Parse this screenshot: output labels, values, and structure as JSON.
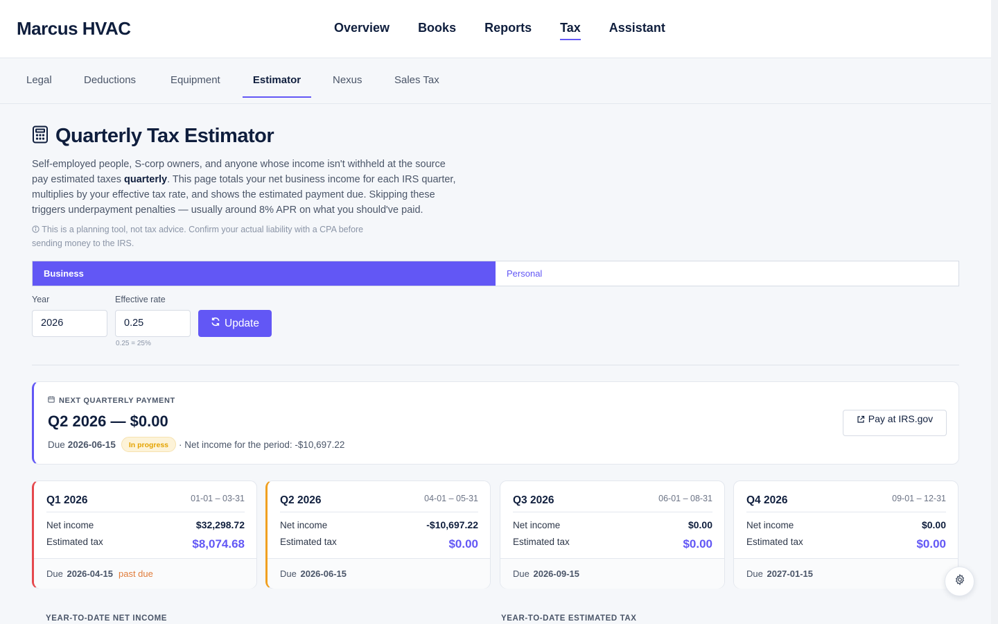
{
  "app": {
    "brand": "Marcus HVAC"
  },
  "mainnav": {
    "items": [
      "Overview",
      "Books",
      "Reports",
      "Tax",
      "Assistant"
    ],
    "active": "Tax"
  },
  "subnav": {
    "items": [
      "Legal",
      "Deductions",
      "Equipment",
      "Estimator",
      "Nexus",
      "Sales Tax"
    ],
    "active": "Estimator"
  },
  "page": {
    "title": "Quarterly Tax Estimator",
    "intro_a": "Self-employed people, S-corp owners, and anyone whose income isn't withheld at the source pay estimated taxes ",
    "intro_bold": "quarterly",
    "intro_b": ". This page totals your net business income for each IRS quarter, multiplies by your effective tax rate, and shows the estimated payment due. Skipping these triggers underpayment penalties — usually around 8% APR on what you should've paid.",
    "disclaimer": "This is a planning tool, not tax advice. Confirm your actual liability with a CPA before sending money to the IRS."
  },
  "toggle": {
    "business": "Business",
    "personal": "Personal",
    "selected": "Business"
  },
  "form": {
    "year_label": "Year",
    "year_value": "2026",
    "rate_label": "Effective rate",
    "rate_value": "0.25",
    "rate_hint": "0.25 = 25%",
    "update_label": "Update"
  },
  "next_payment": {
    "eyebrow": "NEXT QUARTERLY PAYMENT",
    "heading": "Q2 2026 — $0.00",
    "due_prefix": "Due",
    "due_date": "2026-06-15",
    "status": "In progress",
    "net_text": "· Net income for the period: -$10,697.22",
    "pay_label": "Pay at IRS.gov"
  },
  "quarters": [
    {
      "name": "Q1 2026",
      "range": "01-01 – 03-31",
      "net_label": "Net income",
      "net": "$32,298.72",
      "tax_label": "Estimated tax",
      "tax": "$8,074.68",
      "due_prefix": "Due",
      "due": "2026-04-15",
      "flag": "past due",
      "accent": "#e5484d"
    },
    {
      "name": "Q2 2026",
      "range": "04-01 – 05-31",
      "net_label": "Net income",
      "net": "-$10,697.22",
      "tax_label": "Estimated tax",
      "tax": "$0.00",
      "due_prefix": "Due",
      "due": "2026-06-15",
      "flag": "",
      "accent": "#f0a020"
    },
    {
      "name": "Q3 2026",
      "range": "06-01 – 08-31",
      "net_label": "Net income",
      "net": "$0.00",
      "tax_label": "Estimated tax",
      "tax": "$0.00",
      "due_prefix": "Due",
      "due": "2026-09-15",
      "flag": "",
      "accent": ""
    },
    {
      "name": "Q4 2026",
      "range": "09-01 – 12-31",
      "net_label": "Net income",
      "net": "$0.00",
      "tax_label": "Estimated tax",
      "tax": "$0.00",
      "due_prefix": "Due",
      "due": "2027-01-15",
      "flag": "",
      "accent": ""
    }
  ],
  "sections": {
    "ytd_net": "YEAR-TO-DATE NET INCOME",
    "ytd_tax": "YEAR-TO-DATE ESTIMATED TAX"
  },
  "colors": {
    "accent": "#6257f5",
    "navy": "#0f1e3d",
    "past_due": "#e07b39",
    "in_progress_bg": "#fdf3d8"
  },
  "icons": {
    "title": "calculator-icon",
    "info": "info-icon",
    "update": "refresh-icon",
    "eyebrow": "calendar-icon",
    "pay": "external-link-icon",
    "fab": "gear-icon"
  }
}
